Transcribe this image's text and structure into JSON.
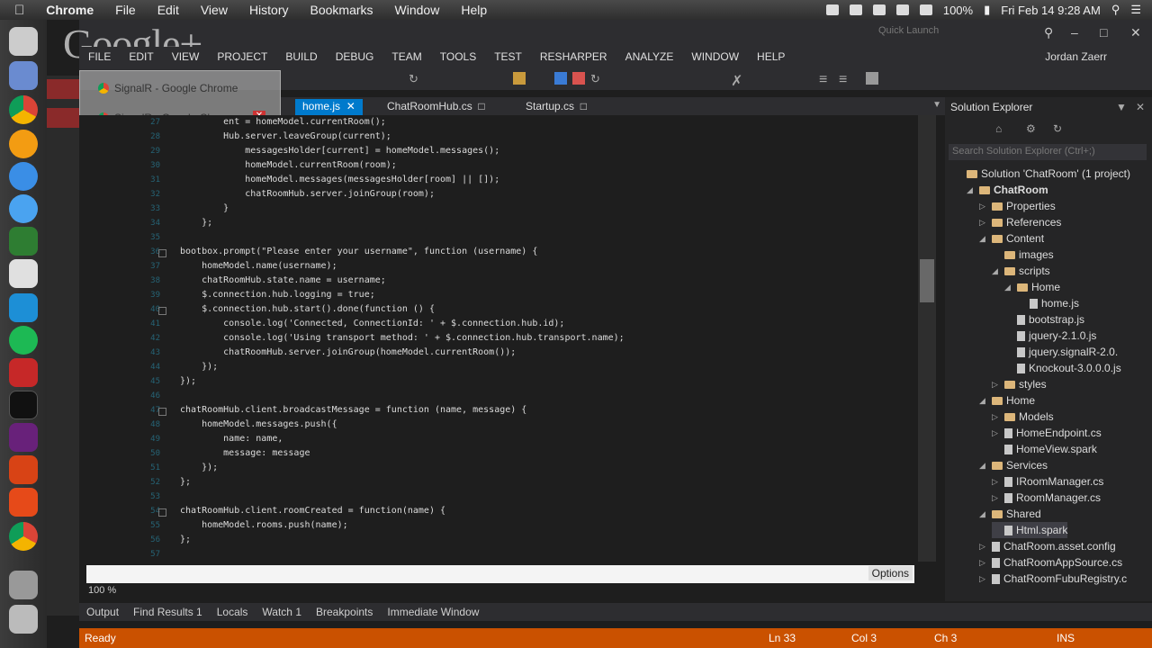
{
  "macbar": {
    "app": "Chrome",
    "menus": [
      "File",
      "Edit",
      "View",
      "History",
      "Bookmarks",
      "Window",
      "Help"
    ],
    "battery": "100%",
    "datetime": "Fri Feb 14  9:28 AM"
  },
  "google_plus": "Google+",
  "chrome_popup": {
    "items": [
      "SignalR - Google Chrome",
      "SignalR - Google Chrome"
    ]
  },
  "vs": {
    "quick_launch": "Quick Launch",
    "menus": [
      "FILE",
      "EDIT",
      "VIEW",
      "PROJECT",
      "BUILD",
      "DEBUG",
      "TEAM",
      "TOOLS",
      "TEST",
      "RESHARPER",
      "ANALYZE",
      "WINDOW",
      "HELP"
    ],
    "user": "Jordan Zaerr",
    "tabs": [
      "home.js",
      "ChatRoomHub.cs",
      "Startup.cs"
    ],
    "code": {
      "lines": [
        {
          "n": "27",
          "t": "        ent = homeModel.currentRoom();"
        },
        {
          "n": "28",
          "t": "        Hub.server.leaveGroup(current);"
        },
        {
          "n": "29",
          "t": "            messagesHolder[current] = homeModel.messages();"
        },
        {
          "n": "30",
          "t": "            homeModel.currentRoom(room);"
        },
        {
          "n": "31",
          "t": "            homeModel.messages(messagesHolder[room] || []);"
        },
        {
          "n": "32",
          "t": "            chatRoomHub.server.joinGroup(room);"
        },
        {
          "n": "33",
          "t": "        }"
        },
        {
          "n": "34",
          "t": "    };"
        },
        {
          "n": "35",
          "t": ""
        },
        {
          "n": "36",
          "t": "bootbox.prompt(\"Please enter your username\", function (username) {"
        },
        {
          "n": "37",
          "t": "    homeModel.name(username);"
        },
        {
          "n": "38",
          "t": "    chatRoomHub.state.name = username;"
        },
        {
          "n": "39",
          "t": "    $.connection.hub.logging = true;"
        },
        {
          "n": "40",
          "t": "    $.connection.hub.start().done(function () {"
        },
        {
          "n": "41",
          "t": "        console.log('Connected, ConnectionId: ' + $.connection.hub.id);"
        },
        {
          "n": "42",
          "t": "        console.log('Using transport method: ' + $.connection.hub.transport.name);"
        },
        {
          "n": "43",
          "t": "        chatRoomHub.server.joinGroup(homeModel.currentRoom());"
        },
        {
          "n": "44",
          "t": "    });"
        },
        {
          "n": "45",
          "t": "});"
        },
        {
          "n": "46",
          "t": ""
        },
        {
          "n": "47",
          "t": "chatRoomHub.client.broadcastMessage = function (name, message) {"
        },
        {
          "n": "48",
          "t": "    homeModel.messages.push({"
        },
        {
          "n": "49",
          "t": "        name: name,"
        },
        {
          "n": "50",
          "t": "        message: message"
        },
        {
          "n": "51",
          "t": "    });"
        },
        {
          "n": "52",
          "t": "};"
        },
        {
          "n": "53",
          "t": ""
        },
        {
          "n": "54",
          "t": "chatRoomHub.client.roomCreated = function(name) {"
        },
        {
          "n": "55",
          "t": "    homeModel.rooms.push(name);"
        },
        {
          "n": "56",
          "t": "};"
        },
        {
          "n": "57",
          "t": ""
        }
      ]
    },
    "find_options": "Options",
    "zoom": "100 %",
    "bottom_tabs": [
      "Output",
      "Find Results 1",
      "Locals",
      "Watch 1",
      "Breakpoints",
      "Immediate Window"
    ],
    "status": {
      "ready": "Ready",
      "ln": "Ln 33",
      "col": "Col 3",
      "ch": "Ch 3",
      "ins": "INS"
    },
    "accent": "#ca5100"
  },
  "solution_explorer": {
    "title": "Solution Explorer",
    "search_placeholder": "Search Solution Explorer (Ctrl+;)",
    "items": [
      {
        "label": "Solution 'ChatRoom' (1 project)",
        "kind": "solution"
      },
      {
        "label": "ChatRoom",
        "kind": "project"
      },
      {
        "label": "Properties",
        "kind": "folder"
      },
      {
        "label": "References",
        "kind": "folder"
      },
      {
        "label": "Content",
        "kind": "folder"
      },
      {
        "label": "images",
        "kind": "folder"
      },
      {
        "label": "scripts",
        "kind": "folder"
      },
      {
        "label": "Home",
        "kind": "folder"
      },
      {
        "label": "home.js",
        "kind": "file"
      },
      {
        "label": "bootstrap.js",
        "kind": "file"
      },
      {
        "label": "jquery-2.1.0.js",
        "kind": "file"
      },
      {
        "label": "jquery.signalR-2.0.",
        "kind": "file"
      },
      {
        "label": "Knockout-3.0.0.0.js",
        "kind": "file"
      },
      {
        "label": "styles",
        "kind": "folder"
      },
      {
        "label": "Home",
        "kind": "folder"
      },
      {
        "label": "Models",
        "kind": "folder"
      },
      {
        "label": "HomeEndpoint.cs",
        "kind": "file"
      },
      {
        "label": "HomeView.spark",
        "kind": "file"
      },
      {
        "label": "Services",
        "kind": "folder"
      },
      {
        "label": "IRoomManager.cs",
        "kind": "file"
      },
      {
        "label": "RoomManager.cs",
        "kind": "file"
      },
      {
        "label": "Shared",
        "kind": "folder"
      },
      {
        "label": "Html.spark",
        "kind": "file"
      },
      {
        "label": "ChatRoom.asset.config",
        "kind": "file"
      },
      {
        "label": "ChatRoomAppSource.cs",
        "kind": "file"
      },
      {
        "label": "ChatRoomFubuRegistry.c",
        "kind": "file"
      }
    ]
  }
}
